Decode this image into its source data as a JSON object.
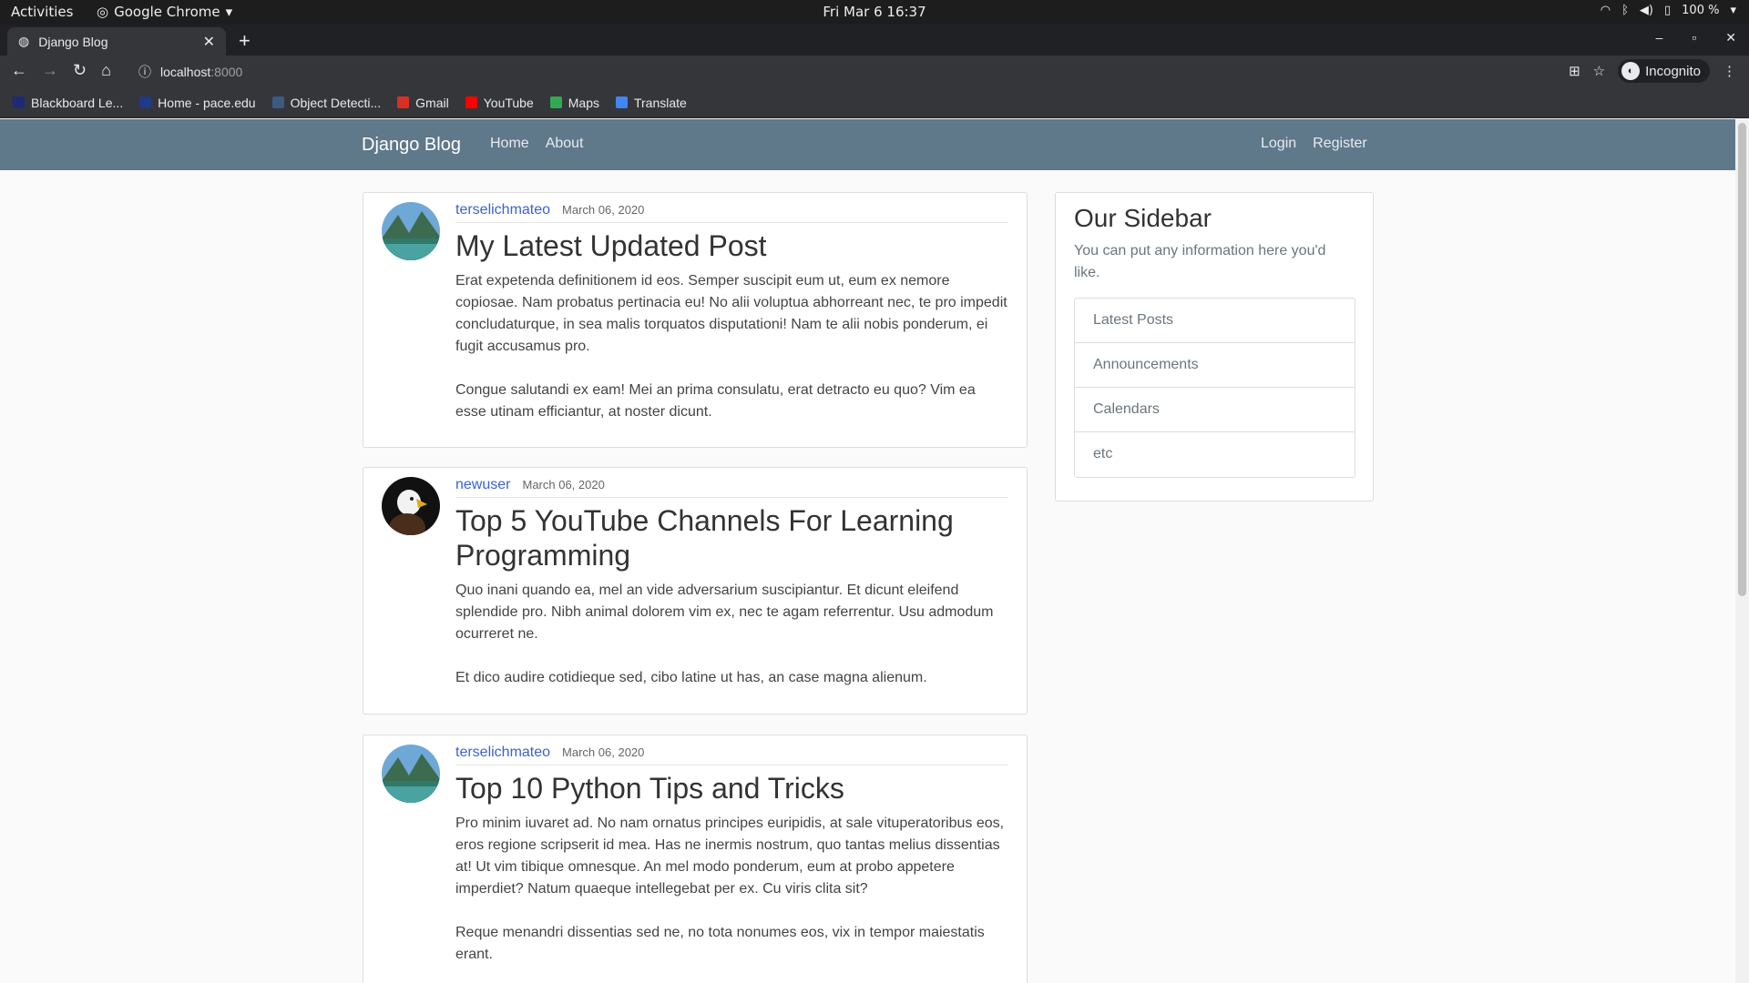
{
  "os_bar": {
    "activities": "Activities",
    "app_name": "Google Chrome",
    "clock": "Fri Mar 6  16:37",
    "battery": "100 %"
  },
  "browser": {
    "tab_title": "Django Blog",
    "url_host": "localhost",
    "url_port": ":8000",
    "profile": "Incognito",
    "bookmarks": [
      {
        "label": "Blackboard Le...",
        "color": "#1e2a78"
      },
      {
        "label": "Home - pace.edu",
        "color": "#1e3a8a"
      },
      {
        "label": "Object Detecti...",
        "color": "#3d5a80"
      },
      {
        "label": "Gmail",
        "color": "#d93025"
      },
      {
        "label": "YouTube",
        "color": "#ff0000"
      },
      {
        "label": "Maps",
        "color": "#34a853"
      },
      {
        "label": "Translate",
        "color": "#4285f4"
      }
    ]
  },
  "site": {
    "brand": "Django Blog",
    "nav": {
      "home": "Home",
      "about": "About",
      "login": "Login",
      "register": "Register"
    },
    "colors": {
      "navbar": "#5f788a",
      "author_link": "#3b63d0"
    }
  },
  "posts": [
    {
      "author": "terselichmateo",
      "date": "March 06, 2020",
      "title": "My Latest Updated Post",
      "paragraphs": [
        "Erat expetenda definitionem id eos. Semper suscipit eum ut, eum ex nemore copiosae. Nam probatus pertinacia eu! No alii voluptua abhorreant nec, te pro impedit concludaturque, in sea malis torquatos disputationi! Nam te alii nobis ponderum, ei fugit accusamus pro.",
        "Congue salutandi ex eam! Mei an prima consulatu, erat detracto eu quo? Vim ea esse utinam efficiantur, at noster dicunt."
      ]
    },
    {
      "author": "newuser",
      "date": "March 06, 2020",
      "title": "Top 5 YouTube Channels For Learning Programming",
      "paragraphs": [
        "Quo inani quando ea, mel an vide adversarium suscipiantur. Et dicunt eleifend splendide pro. Nibh animal dolorem vim ex, nec te agam referrentur. Usu admodum ocurreret ne.",
        "Et dico audire cotidieque sed, cibo latine ut has, an case magna alienum."
      ]
    },
    {
      "author": "terselichmateo",
      "date": "March 06, 2020",
      "title": "Top 10 Python Tips and Tricks",
      "paragraphs": [
        "Pro minim iuvaret ad. No nam ornatus principes euripidis, at sale vituperatoribus eos, eros regione scripserit id mea. Has ne inermis nostrum, quo tantas melius dissentias at! Ut vim tibique omnesque. An mel modo ponderum, eum at probo appetere imperdiet? Natum quaeque intellegebat per ex. Cu viris clita sit?",
        "Reque menandri dissentias sed ne, no tota nonumes eos, vix in tempor maiestatis erant."
      ]
    }
  ],
  "sidebar": {
    "title": "Our Sidebar",
    "description": "You can put any information here you'd like.",
    "items": [
      "Latest Posts",
      "Announcements",
      "Calendars",
      "etc"
    ]
  }
}
